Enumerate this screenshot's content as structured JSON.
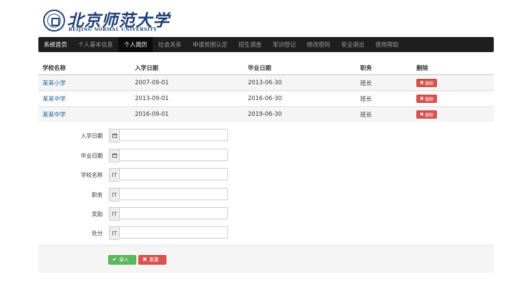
{
  "header": {
    "brand_cn": "北京师范大学",
    "brand_en": "BEIJING NORMAL UNIVERSITY"
  },
  "nav": {
    "items": [
      "系统首页",
      "个人基本信息",
      "个人简历",
      "社会关系",
      "申请贫困认定",
      "招生调查",
      "军训登记",
      "修改密码",
      "安全退出",
      "使用帮助"
    ],
    "active_index": 2
  },
  "table": {
    "headers": [
      "学校名称",
      "入学日期",
      "毕业日期",
      "职务",
      "删除"
    ],
    "delete_label": "删除",
    "rows": [
      {
        "school": "某某小学",
        "start": "2007-09-01",
        "end": "2013-06-30",
        "position": "班长"
      },
      {
        "school": "某某中学",
        "start": "2013-09-01",
        "end": "2016-06-30",
        "position": "班长"
      },
      {
        "school": "某某中学",
        "start": "2016-09-01",
        "end": "2019-06-30",
        "position": "班长"
      }
    ]
  },
  "form": {
    "fields": [
      {
        "label": "入学日期",
        "addon": "calendar",
        "value": ""
      },
      {
        "label": "毕业日期",
        "addon": "calendar",
        "value": ""
      },
      {
        "label": "学校名称",
        "addon": "IT",
        "value": ""
      },
      {
        "label": "职务",
        "addon": "IT",
        "value": ""
      },
      {
        "label": "奖励",
        "addon": "IT",
        "value": ""
      },
      {
        "label": "处分",
        "addon": "IT",
        "value": ""
      }
    ],
    "submit_label": "录入",
    "reset_label": "重置"
  }
}
